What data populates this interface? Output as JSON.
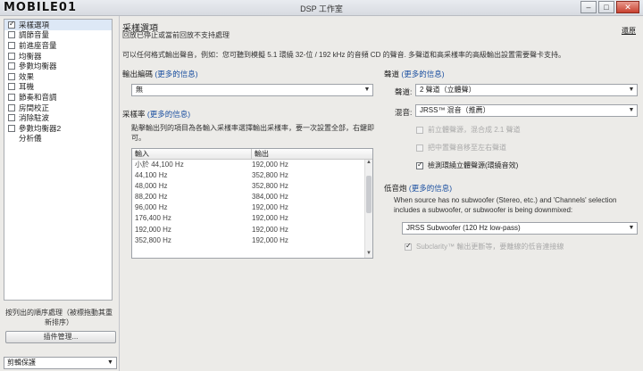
{
  "window": {
    "title": "DSP 工作室",
    "watermark": "MOBILE01",
    "min": "–",
    "max": "□",
    "close": "✕"
  },
  "effects": [
    {
      "label": "采樣選項",
      "checked": true,
      "selected": true,
      "has_checkbox": true
    },
    {
      "label": "調節音量",
      "checked": false,
      "has_checkbox": true
    },
    {
      "label": "前進座音量",
      "checked": false,
      "has_checkbox": true
    },
    {
      "label": "均衡器",
      "checked": false,
      "has_checkbox": true
    },
    {
      "label": "參數均衡器",
      "checked": false,
      "has_checkbox": true
    },
    {
      "label": "效果",
      "checked": false,
      "has_checkbox": true
    },
    {
      "label": "耳機",
      "checked": false,
      "has_checkbox": true
    },
    {
      "label": "節奏和音調",
      "checked": false,
      "has_checkbox": true
    },
    {
      "label": "房間校正",
      "checked": false,
      "has_checkbox": true
    },
    {
      "label": "消除駐波",
      "checked": false,
      "has_checkbox": true
    },
    {
      "label": "參數均衡器2",
      "checked": false,
      "has_checkbox": true
    },
    {
      "label": "分析儀",
      "checked": false,
      "has_checkbox": false
    }
  ],
  "left_footer": {
    "order_note": "按列出的順序處理（被標拖動其重新排序）",
    "plugin_button": "插件管理...",
    "preset": "剪輯保護"
  },
  "main": {
    "title": "采樣選項",
    "subtitle": "回放已停止或當前回放不支持處理",
    "restore": "還原",
    "description": "可以任何格式輸出聲音，例如：您可聽到模擬 5.1 環繞 32-位 / 192 kHz 的音頻 CD 的聲音. 多聲道和高采樣率的高級輸出設置需要聲卡支持。"
  },
  "output_format": {
    "label": "輸出編碼",
    "more": "(更多的信息)",
    "value": "無"
  },
  "sample_rate": {
    "label": "采樣率",
    "more": "(更多的信息)",
    "hint": "點擊輸出列的項目為各輸入采樣率選擇輸出采樣率，要一次設置全部，右鍵即可。",
    "col_input": "輸入",
    "col_output": "輸出",
    "rows": [
      [
        "小於 44,100 Hz",
        "192,000 Hz"
      ],
      [
        "44,100 Hz",
        "352,800 Hz"
      ],
      [
        "48,000 Hz",
        "352,800 Hz"
      ],
      [
        "88,200 Hz",
        "384,000 Hz"
      ],
      [
        "96,000 Hz",
        "192,000 Hz"
      ],
      [
        "176,400 Hz",
        "192,000 Hz"
      ],
      [
        "192,000 Hz",
        "192,000 Hz"
      ],
      [
        "352,800 Hz",
        "192,000 Hz"
      ]
    ]
  },
  "channels": {
    "label": "聲道",
    "more": "(更多的信息)",
    "channel_label": "聲道:",
    "channel_value": "2 聲道（立體聲）",
    "mix_label": "混音:",
    "mix_value": "JRSS™ 混音（推薦）",
    "opt1": "前立體聲源，混合成 2.1 聲道",
    "opt2": "把中置聲音移至左右聲道",
    "opt3": "檢測環繞立體聲源(環繞音效)"
  },
  "subwoofer": {
    "label": "低音炮",
    "more": "(更多的信息)",
    "text": "When source has no subwoofer (Stereo, etc.) and 'Channels' selection includes a subwoofer, or subwoofer is being downmixed:",
    "value": "JRSS Subwoofer (120 Hz low-pass)",
    "subclarity": "Subclarity™ 輸出更斷等，要離線的低音連接線"
  }
}
